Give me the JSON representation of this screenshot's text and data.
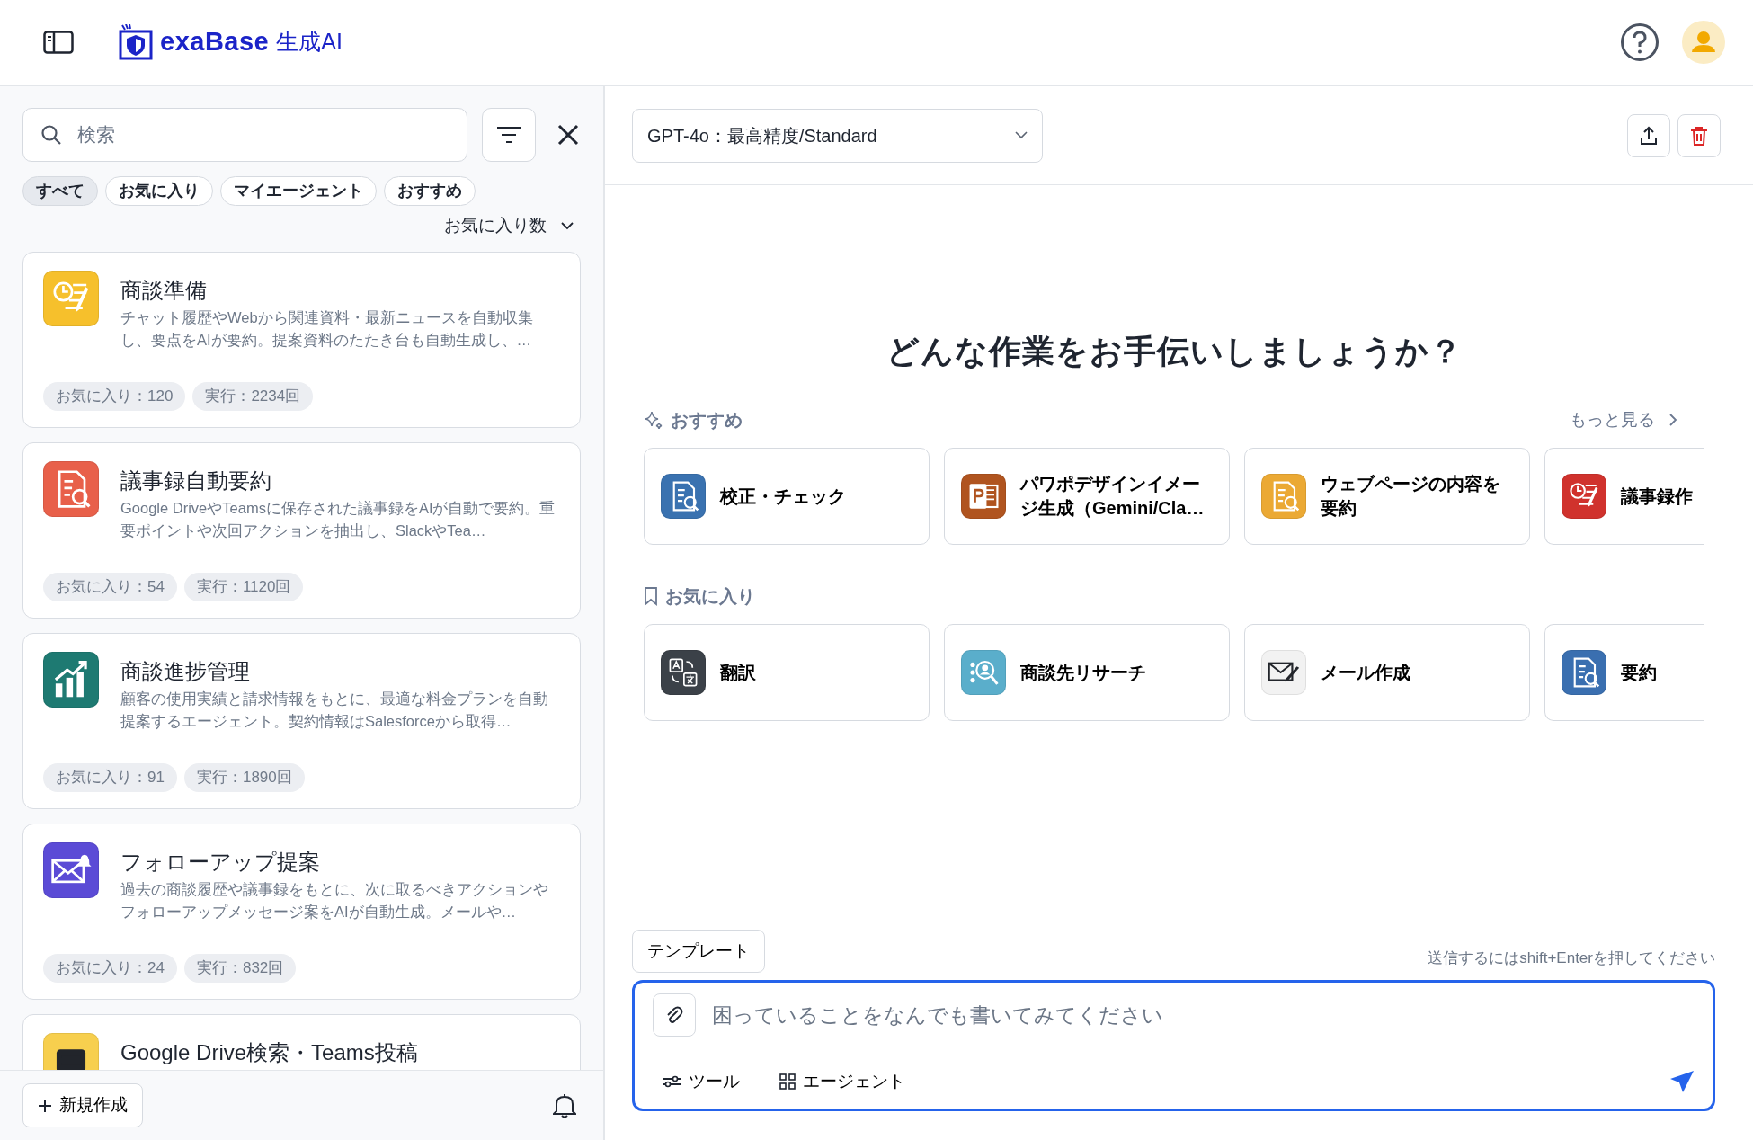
{
  "header": {
    "brand": "exaBase",
    "product": "生成AI"
  },
  "sidebar": {
    "search": {
      "placeholder": "検索"
    },
    "filters": [
      {
        "label": "すべて",
        "selected": true
      },
      {
        "label": "お気に入り",
        "selected": false
      },
      {
        "label": "マイエージェント",
        "selected": false
      },
      {
        "label": "おすすめ",
        "selected": false
      }
    ],
    "sort": "お気に入り数",
    "agents": [
      {
        "title": "商談準備",
        "description": "チャット履歴やWebから関連資料・最新ニュースを自動収集し、要点をAIが要約。提案資料のたたき台も自動生成し、…",
        "favorites": "お気に入り：120",
        "runs": "実行：2234回",
        "color": "#f6c02c"
      },
      {
        "title": "議事録自動要約",
        "description": "Google DriveやTeamsに保存された議事録をAIが自動で要約。重要ポイントや次回アクションを抽出し、SlackやTea…",
        "favorites": "お気に入り：54",
        "runs": "実行：1120回",
        "color": "#e8604a"
      },
      {
        "title": "商談進捗管理",
        "description": "顧客の使用実績と請求情報をもとに、最適な料金プランを自動提案するエージェント。契約情報はSalesforceから取得…",
        "favorites": "お気に入り：91",
        "runs": "実行：1890回",
        "color": "#1e7a72"
      },
      {
        "title": "フォローアップ提案",
        "description": "過去の商談履歴や議事録をもとに、次に取るべきアクションやフォローアップメッセージ案をAIが自動生成。メールや…",
        "favorites": "お気に入り：24",
        "runs": "実行：832回",
        "color": "#5b4bd6"
      },
      {
        "title": "Google Drive検索・Teams投稿",
        "color": "#f7cf4e"
      }
    ],
    "new_button": "新規作成"
  },
  "main": {
    "model": "GPT-4o：最高精度/Standard",
    "heading": "どんな作業をお手伝いしましょうか？",
    "recommended": {
      "title": "おすすめ",
      "more": "もっと見る",
      "items": [
        {
          "label": "校正・チェック",
          "color": "#3a72b0"
        },
        {
          "label": "パワポデザインイメージ生成（Gemini/Cla…",
          "color": "#b0541f"
        },
        {
          "label": "ウェブページの内容を要約",
          "color": "#eba934"
        },
        {
          "label": "議事録作",
          "color": "#d0322d"
        }
      ]
    },
    "favorites": {
      "title": "お気に入り",
      "items": [
        {
          "label": "翻訳",
          "color": "#3b4148"
        },
        {
          "label": "商談先リサーチ",
          "color": "#5aaecb"
        },
        {
          "label": "メール作成",
          "color": "#f2f2f2"
        },
        {
          "label": "要約",
          "color": "#3a6fb0"
        }
      ]
    },
    "template_button": "テンプレート",
    "hint": "送信するにはshift+Enterを押してください",
    "input": {
      "placeholder": "困っていることをなんでも書いてみてください"
    },
    "tools": [
      "ツール",
      "エージェント"
    ]
  }
}
